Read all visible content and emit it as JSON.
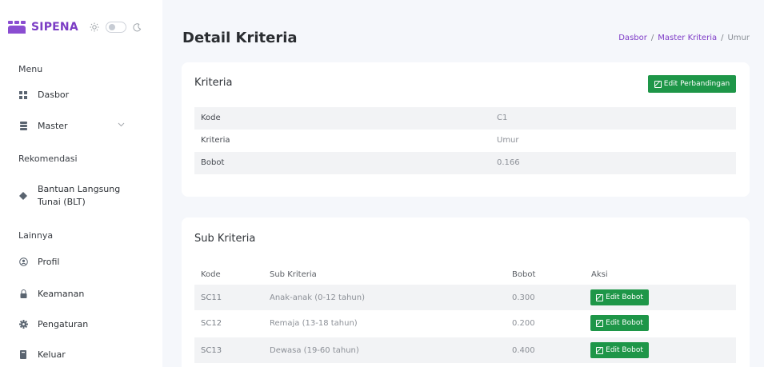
{
  "brand": {
    "name": "SIPENA",
    "logo_icon": "people-logo-icon",
    "accent": "#7b3cc4"
  },
  "sidebar": {
    "sections": [
      {
        "header": "Menu",
        "items": [
          {
            "label": "Dasbor",
            "icon": "grid-icon"
          },
          {
            "label": "Master",
            "icon": "database-icon",
            "has_chevron": true
          }
        ]
      },
      {
        "header": "Rekomendasi",
        "items": [
          {
            "label": "Bantuan Langsung Tunai (BLT)",
            "line1": "Bantuan Langsung",
            "line2": "Tunai (BLT)",
            "icon": "diamond-icon"
          }
        ]
      },
      {
        "header": "Lainnya",
        "items": [
          {
            "label": "Profil",
            "icon": "user-circle-icon"
          },
          {
            "label": "Keamanan",
            "icon": "lock-icon"
          },
          {
            "label": "Pengaturan",
            "icon": "gear-icon"
          },
          {
            "label": "Keluar",
            "icon": "logout-icon"
          }
        ]
      }
    ]
  },
  "page": {
    "title": "Detail Kriteria"
  },
  "breadcrumb": {
    "items": [
      "Dasbor",
      "Master Kriteria"
    ],
    "current": "Umur"
  },
  "kriteria_card": {
    "title": "Kriteria",
    "edit_button": "Edit Perbandingan",
    "rows": [
      {
        "key": "Kode",
        "value": "C1"
      },
      {
        "key": "Kriteria",
        "value": "Umur"
      },
      {
        "key": "Bobot",
        "value": "0.166"
      }
    ]
  },
  "sub_card": {
    "title": "Sub Kriteria",
    "headers": [
      "Kode",
      "Sub Kriteria",
      "Bobot",
      "Aksi"
    ],
    "rows": [
      {
        "kode": "SC11",
        "sub": "Anak-anak (0-12 tahun)",
        "bobot": "0.300",
        "action": "Edit Bobot"
      },
      {
        "kode": "SC12",
        "sub": "Remaja (13-18 tahun)",
        "bobot": "0.200",
        "action": "Edit Bobot"
      },
      {
        "kode": "SC13",
        "sub": "Dewasa (19-60 tahun)",
        "bobot": "0.400",
        "action": "Edit Bobot"
      }
    ]
  },
  "colors": {
    "button": "#1e9648",
    "link": "#7e3bc7",
    "background": "#f5f7fb"
  }
}
